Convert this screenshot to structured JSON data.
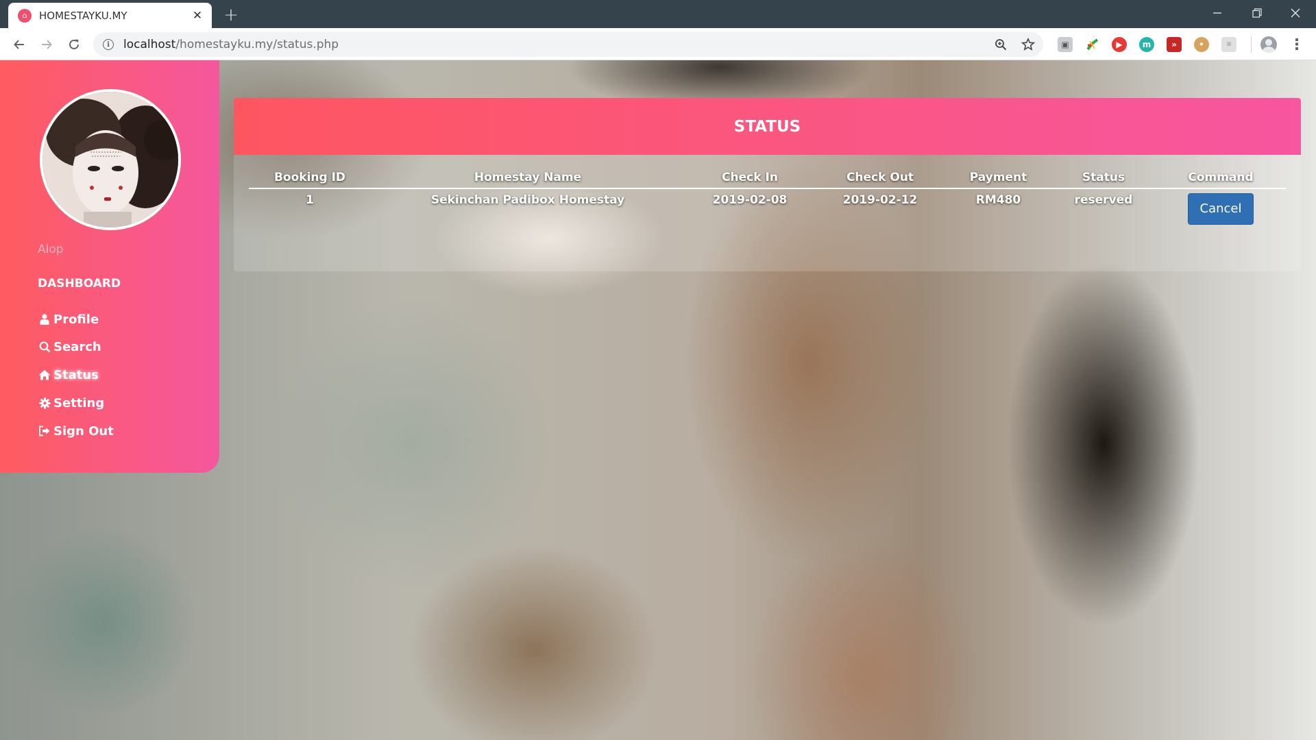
{
  "browser": {
    "tab_title": "HOMESTAYKU.MY",
    "url_host": "localhost",
    "url_path": "/homestayku.my/status.php",
    "new_tab_symbol": "+",
    "close_symbol": "✕"
  },
  "sidebar": {
    "username": "Alop",
    "heading": "DASHBOARD",
    "items": [
      {
        "label": "Profile",
        "icon": "user-icon",
        "active": false
      },
      {
        "label": "Search",
        "icon": "search-icon",
        "active": false
      },
      {
        "label": "Status",
        "icon": "home-icon",
        "active": true
      },
      {
        "label": "Setting",
        "icon": "gear-icon",
        "active": false
      },
      {
        "label": "Sign Out",
        "icon": "sign-out-icon",
        "active": false
      }
    ]
  },
  "status": {
    "title": "STATUS",
    "columns": [
      "Booking ID",
      "Homestay Name",
      "Check In",
      "Check Out",
      "Payment",
      "Status",
      "Command"
    ],
    "rows": [
      {
        "booking_id": "1",
        "homestay_name": "Sekinchan Padibox Homestay",
        "check_in": "2019-02-08",
        "check_out": "2019-02-12",
        "payment": "RM480",
        "status": "reserved",
        "command_label": "Cancel"
      }
    ]
  },
  "colors": {
    "sidebar_gradient_start": "#fe5c60",
    "sidebar_gradient_end": "#f5579e",
    "cancel_button": "#2f6fb3"
  }
}
